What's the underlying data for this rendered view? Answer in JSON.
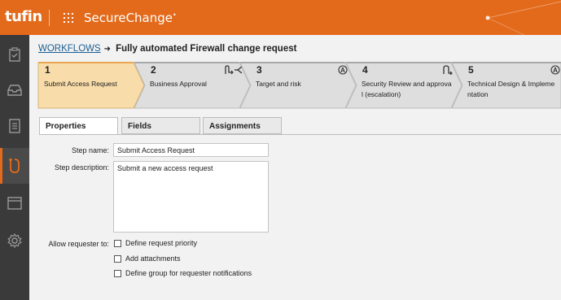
{
  "app": {
    "logo": "tufin",
    "name": "SecureChange"
  },
  "sidebar": {
    "items": [
      {
        "icon": "clipboard-check-icon",
        "active": false
      },
      {
        "icon": "inbox-icon",
        "active": false
      },
      {
        "icon": "document-icon",
        "active": false
      },
      {
        "icon": "workflow-icon",
        "active": true
      },
      {
        "icon": "window-icon",
        "active": false
      },
      {
        "icon": "gear-icon",
        "active": false
      }
    ]
  },
  "breadcrumb": {
    "link": "WORKFLOWS",
    "arrow": "➜",
    "title": "Fully automated Firewall change request"
  },
  "steps": [
    {
      "number": "1",
      "label": "Submit Access Request",
      "active": true,
      "icon": ""
    },
    {
      "number": "2",
      "label": "Business Approval",
      "active": false,
      "icon": "branch-icon"
    },
    {
      "number": "3",
      "label": "Target and risk",
      "active": false,
      "icon": "auto-icon"
    },
    {
      "number": "4",
      "label": "Security Review and approval (escalation)",
      "label_line1": "Security Review and approva",
      "label_line2": "l (escalation)",
      "active": false,
      "icon": "loop-icon"
    },
    {
      "number": "5",
      "label": "Technical Design & Implementation",
      "label_line1": "Technical Design & Impleme",
      "label_line2": "ntation",
      "active": false,
      "icon": "auto-icon"
    }
  ],
  "tabs": [
    {
      "label": "Properties",
      "active": true
    },
    {
      "label": "Fields",
      "active": false
    },
    {
      "label": "Assignments",
      "active": false
    }
  ],
  "form": {
    "step_name_label": "Step name:",
    "step_name_value": "Submit Access Request",
    "step_description_label": "Step description:",
    "step_description_value": "Submit a new access request",
    "allow_requester_label": "Allow requester to:",
    "options": [
      {
        "label": "Define request priority",
        "checked": false
      },
      {
        "label": "Add attachments",
        "checked": false
      },
      {
        "label": "Define group for requester notifications",
        "checked": false
      }
    ]
  },
  "colors": {
    "brand_orange": "#e36a1b",
    "sidebar_bg": "#3a3a3a",
    "active_step": "#f7d9a8",
    "inactive_step": "#dcdcdc",
    "link": "#1a5e91"
  }
}
